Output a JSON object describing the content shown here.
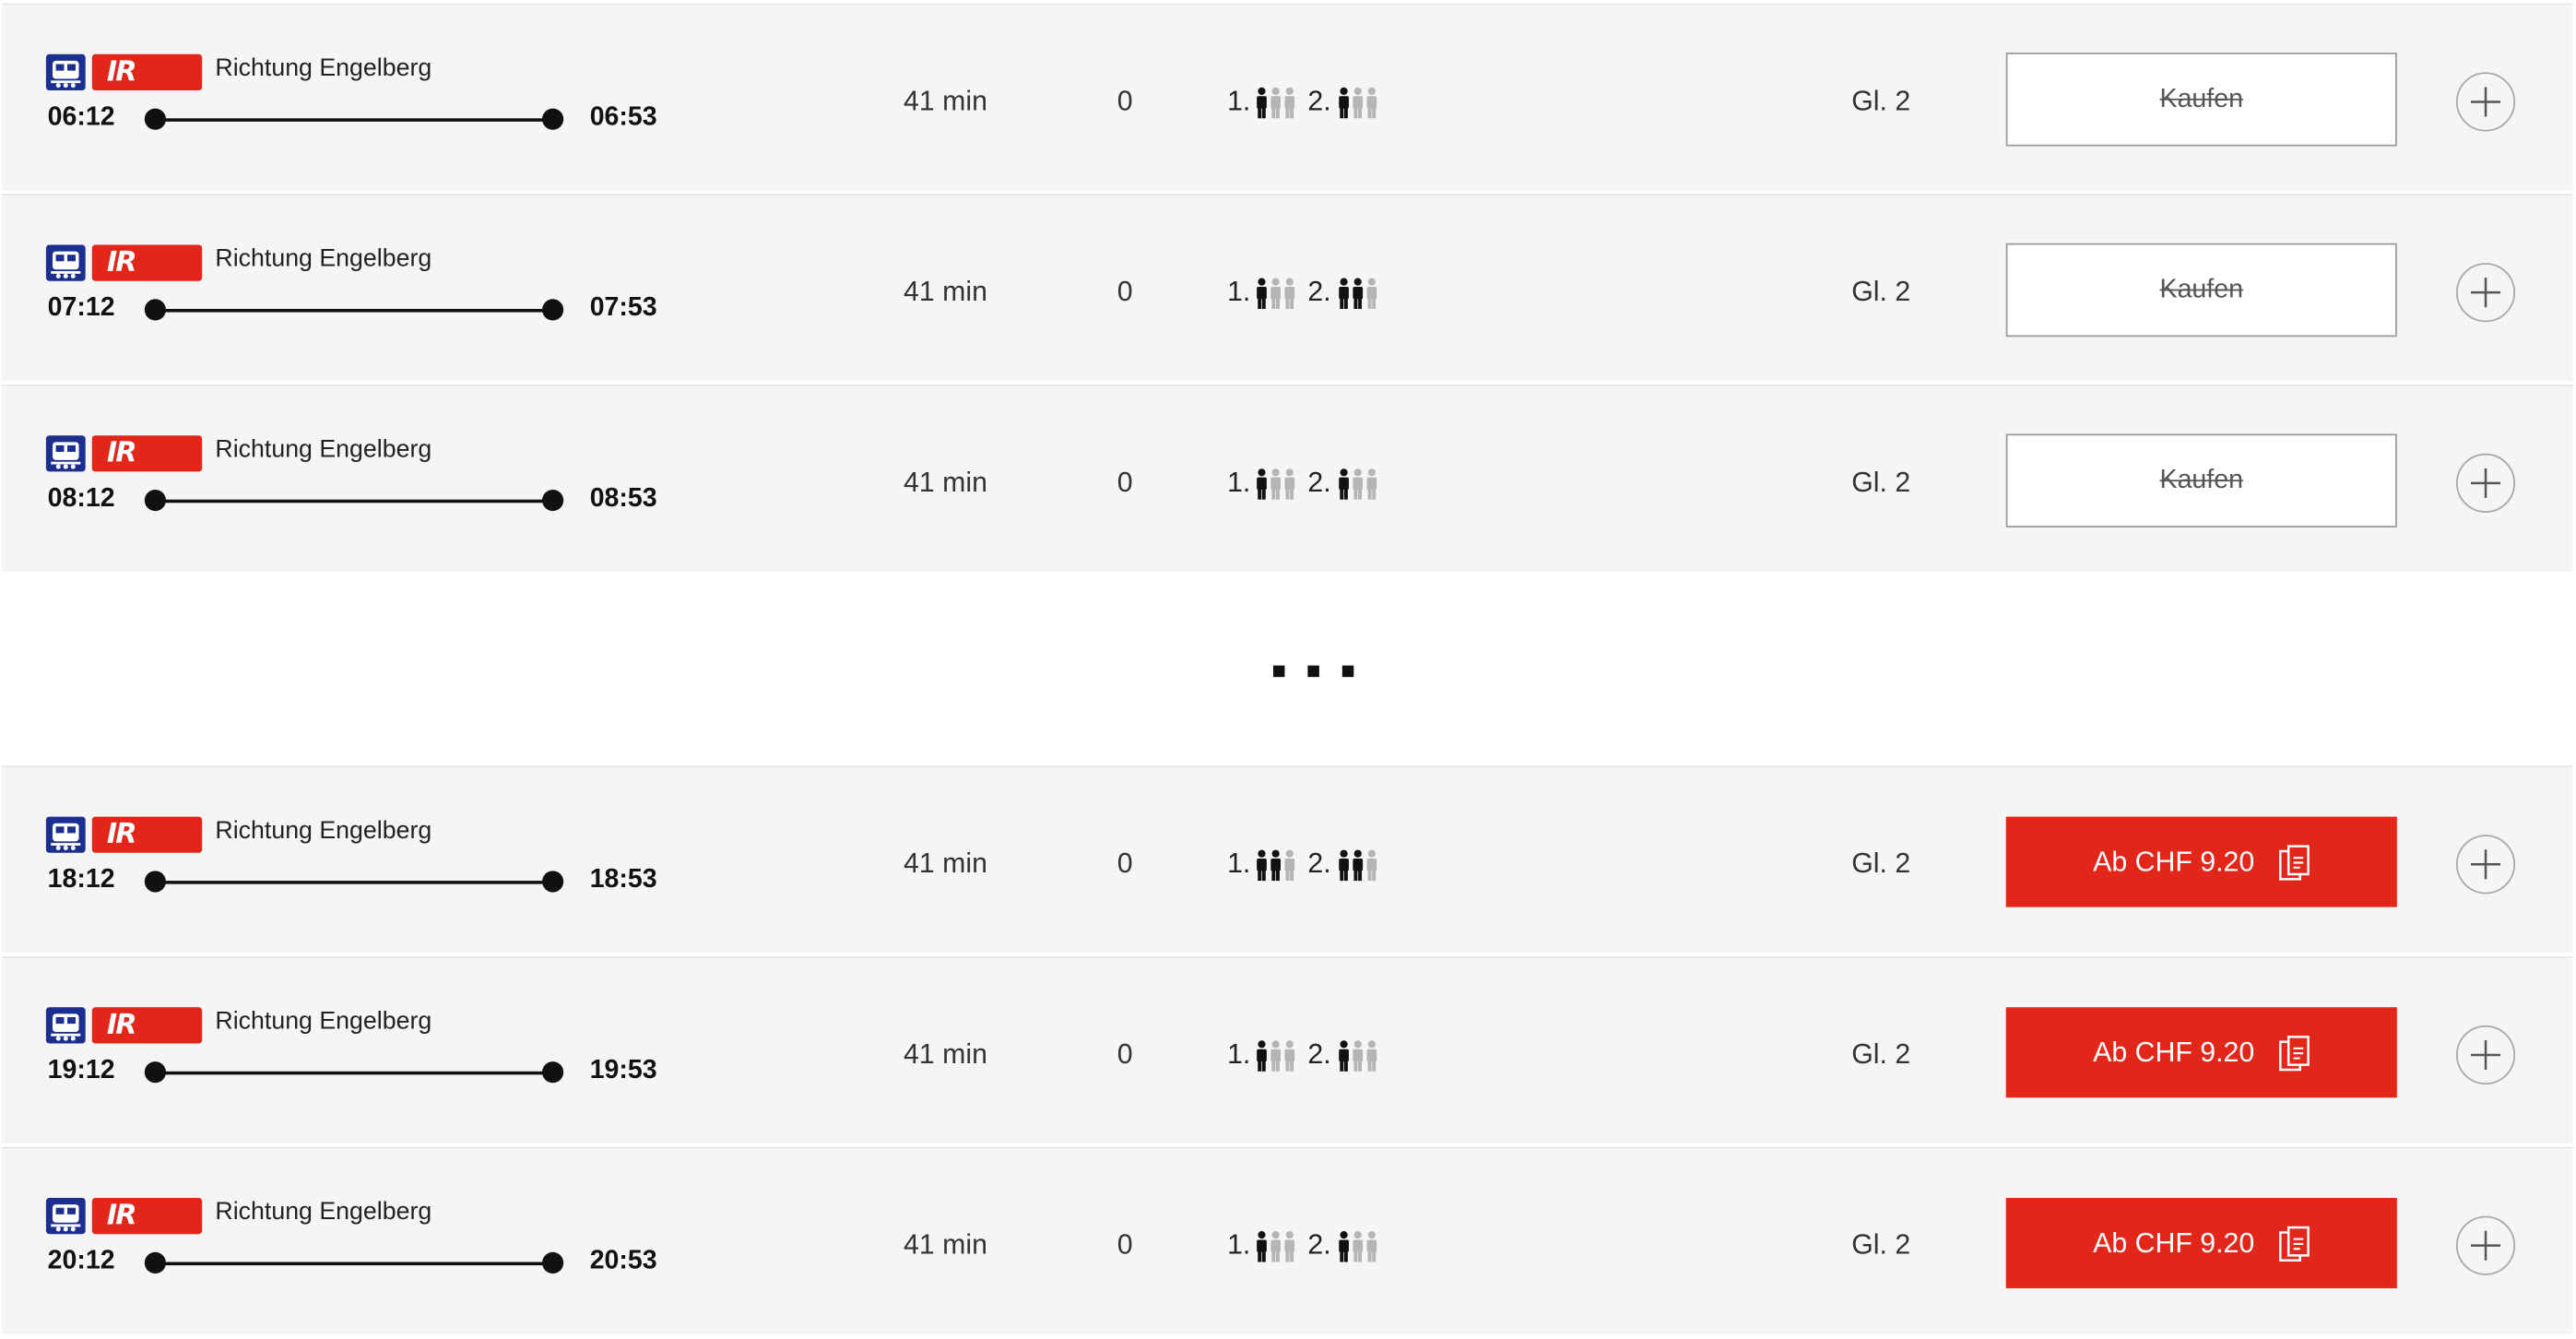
{
  "connections": [
    {
      "product": "IR",
      "direction": "Richtung Engelberg",
      "departure": "06:12",
      "arrival": "06:53",
      "duration": "41 min",
      "changes": "0",
      "class1_label": "1.",
      "class2_label": "2.",
      "class1_occupancy": 1,
      "class2_occupancy": 1,
      "platform": "Gl. 2",
      "action_type": "buy",
      "action_label": "Kaufen"
    },
    {
      "product": "IR",
      "direction": "Richtung Engelberg",
      "departure": "07:12",
      "arrival": "07:53",
      "duration": "41 min",
      "changes": "0",
      "class1_label": "1.",
      "class2_label": "2.",
      "class1_occupancy": 1,
      "class2_occupancy": 2,
      "platform": "Gl. 2",
      "action_type": "buy",
      "action_label": "Kaufen"
    },
    {
      "product": "IR",
      "direction": "Richtung Engelberg",
      "departure": "08:12",
      "arrival": "08:53",
      "duration": "41 min",
      "changes": "0",
      "class1_label": "1.",
      "class2_label": "2.",
      "class1_occupancy": 1,
      "class2_occupancy": 1,
      "platform": "Gl. 2",
      "action_type": "buy",
      "action_label": "Kaufen"
    },
    {
      "product": "IR",
      "direction": "Richtung Engelberg",
      "departure": "18:12",
      "arrival": "18:53",
      "duration": "41 min",
      "changes": "0",
      "class1_label": "1.",
      "class2_label": "2.",
      "class1_occupancy": 2,
      "class2_occupancy": 2,
      "platform": "Gl. 2",
      "action_type": "price",
      "action_label": "Ab CHF 9.20"
    },
    {
      "product": "IR",
      "direction": "Richtung Engelberg",
      "departure": "19:12",
      "arrival": "19:53",
      "duration": "41 min",
      "changes": "0",
      "class1_label": "1.",
      "class2_label": "2.",
      "class1_occupancy": 1,
      "class2_occupancy": 1,
      "platform": "Gl. 2",
      "action_type": "price",
      "action_label": "Ab CHF 9.20"
    },
    {
      "product": "IR",
      "direction": "Richtung Engelberg",
      "departure": "20:12",
      "arrival": "20:53",
      "duration": "41 min",
      "changes": "0",
      "class1_label": "1.",
      "class2_label": "2.",
      "class1_occupancy": 1,
      "class2_occupancy": 1,
      "platform": "Gl. 2",
      "action_type": "price",
      "action_label": "Ab CHF 9.20"
    }
  ],
  "icons": {
    "train": "train-icon",
    "product_badge": "ir-badge",
    "occupancy": "occupancy-person-icon",
    "ticket": "ticket-icon",
    "add": "plus-circle-icon",
    "gap": "ellipsis-icon"
  },
  "colors": {
    "accent": "#e3261a",
    "train_icon": "#1c2f8f",
    "row_background": "#f5f5f5",
    "occupancy_filled": "#111111",
    "occupancy_empty": "#b5b5b5"
  },
  "occupancy_scale": 3
}
